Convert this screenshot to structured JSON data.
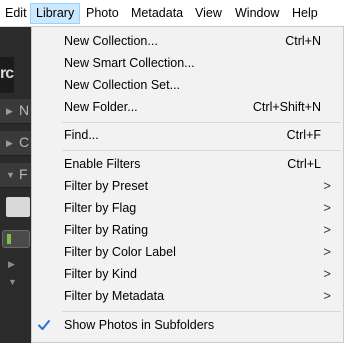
{
  "menubar": {
    "items": [
      "Edit",
      "Library",
      "Photo",
      "Metadata",
      "View",
      "Window",
      "Help"
    ],
    "active": "Library"
  },
  "background": {
    "logo_text": "rc",
    "panel_letters": [
      "N",
      "C",
      "F"
    ]
  },
  "menu": {
    "group1": [
      {
        "label": "New Collection...",
        "shortcut": "Ctrl+N"
      },
      {
        "label": "New Smart Collection...",
        "shortcut": ""
      },
      {
        "label": "New Collection Set...",
        "shortcut": ""
      },
      {
        "label": "New Folder...",
        "shortcut": "Ctrl+Shift+N"
      }
    ],
    "group2": [
      {
        "label": "Find...",
        "shortcut": "Ctrl+F"
      }
    ],
    "group3": [
      {
        "label": "Enable Filters",
        "shortcut": "Ctrl+L",
        "submenu": false
      },
      {
        "label": "Filter by Preset",
        "submenu": true
      },
      {
        "label": "Filter by Flag",
        "submenu": true
      },
      {
        "label": "Filter by Rating",
        "submenu": true
      },
      {
        "label": "Filter by Color Label",
        "submenu": true
      },
      {
        "label": "Filter by Kind",
        "submenu": true
      },
      {
        "label": "Filter by Metadata",
        "submenu": true
      }
    ],
    "group4": [
      {
        "label": "Show Photos in Subfolders",
        "checked": true
      }
    ],
    "submenu_arrow": ">",
    "check_color": "#2f6fd1"
  }
}
